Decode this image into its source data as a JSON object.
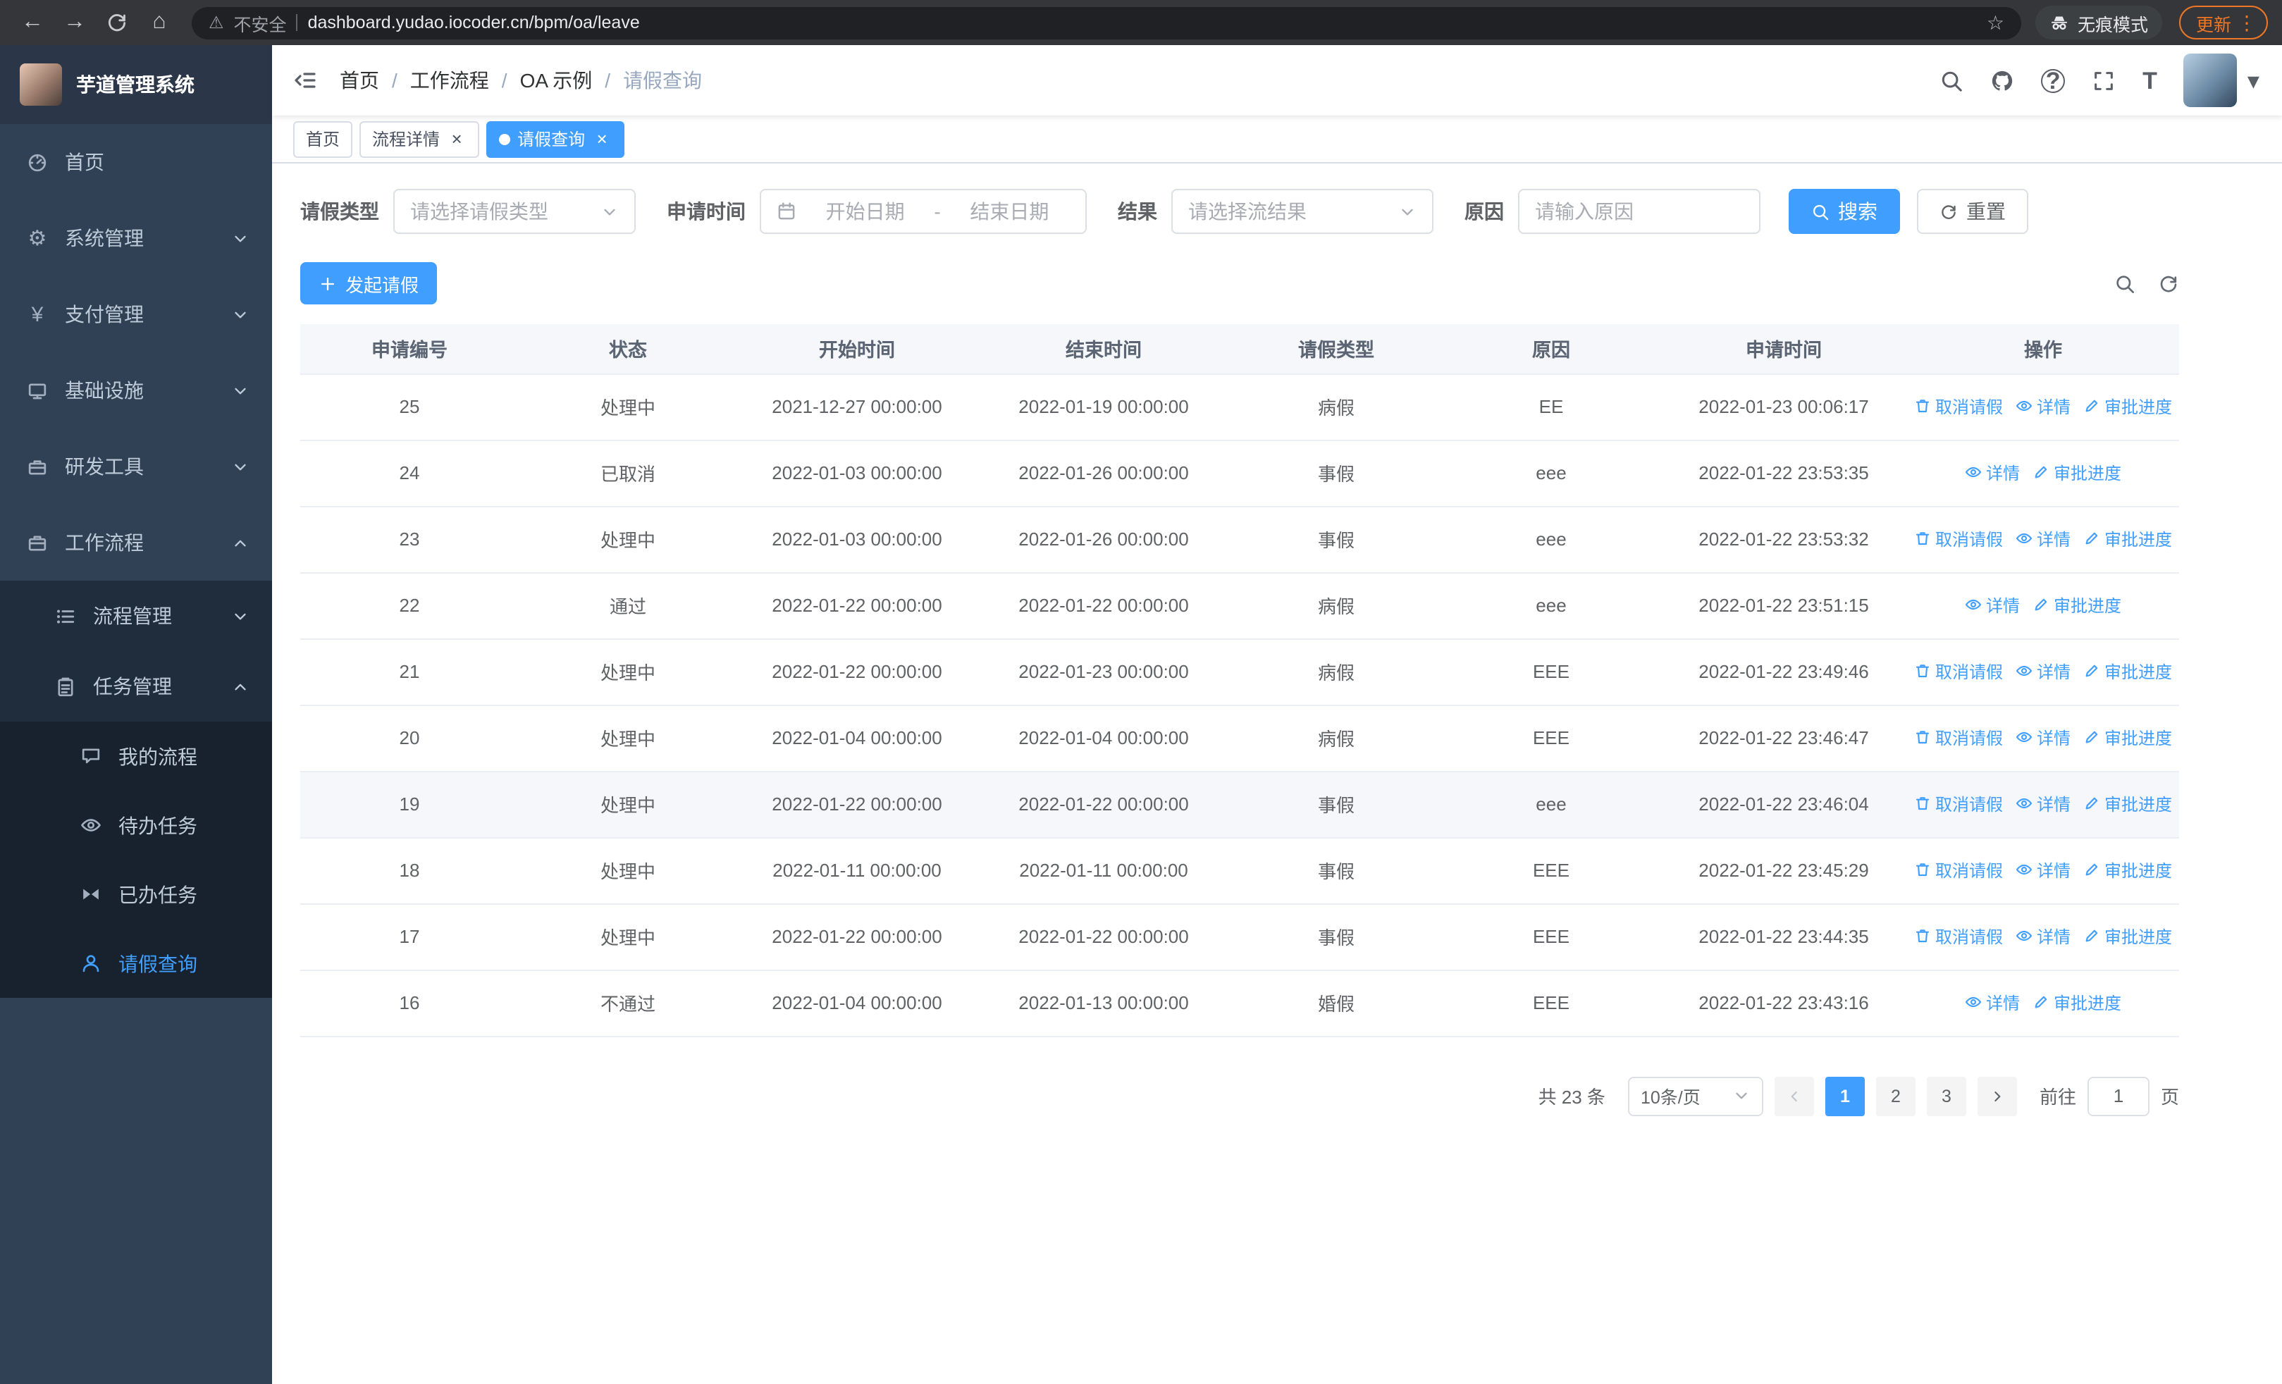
{
  "browser": {
    "security_label": "不安全",
    "url": "dashboard.yudao.iocoder.cn/bpm/oa/leave",
    "incognito_label": "无痕模式",
    "update_label": "更新"
  },
  "sidebar": {
    "logo_title": "芋道管理系统",
    "home": "首页",
    "system": "系统管理",
    "payment": "支付管理",
    "infra": "基础设施",
    "devtools": "研发工具",
    "workflow": "工作流程",
    "process_mgmt": "流程管理",
    "task_mgmt": "任务管理",
    "my_process": "我的流程",
    "todo_tasks": "待办任务",
    "done_tasks": "已办任务",
    "leave_query": "请假查询"
  },
  "breadcrumb": {
    "items": [
      "首页",
      "工作流程",
      "OA 示例",
      "请假查询"
    ],
    "separator": "/"
  },
  "tabs": [
    {
      "label": "首页"
    },
    {
      "label": "流程详情"
    },
    {
      "label": "请假查询"
    }
  ],
  "filter": {
    "type_label": "请假类型",
    "type_placeholder": "请选择请假类型",
    "time_label": "申请时间",
    "start_placeholder": "开始日期",
    "separator": "-",
    "end_placeholder": "结束日期",
    "result_label": "结果",
    "result_placeholder": "请选择流结果",
    "reason_label": "原因",
    "reason_placeholder": "请输入原因",
    "search_label": "搜索",
    "reset_label": "重置"
  },
  "toolbar": {
    "create_label": "发起请假"
  },
  "table": {
    "columns": [
      "申请编号",
      "状态",
      "开始时间",
      "结束时间",
      "请假类型",
      "原因",
      "申请时间",
      "操作"
    ],
    "action_labels": {
      "cancel": "取消请假",
      "detail": "详情",
      "progress": "审批进度"
    },
    "action_icons": {
      "cancel": "trash",
      "detail": "eye",
      "progress": "pen"
    },
    "rows": [
      {
        "id": "25",
        "status": "处理中",
        "start": "2021-12-27 00:00:00",
        "end": "2022-01-19 00:00:00",
        "type": "病假",
        "reason": "EE",
        "applied": "2022-01-23 00:06:17",
        "actions": [
          "cancel",
          "detail",
          "progress"
        ],
        "highlight": false
      },
      {
        "id": "24",
        "status": "已取消",
        "start": "2022-01-03 00:00:00",
        "end": "2022-01-26 00:00:00",
        "type": "事假",
        "reason": "eee",
        "applied": "2022-01-22 23:53:35",
        "actions": [
          "detail",
          "progress"
        ],
        "highlight": false
      },
      {
        "id": "23",
        "status": "处理中",
        "start": "2022-01-03 00:00:00",
        "end": "2022-01-26 00:00:00",
        "type": "事假",
        "reason": "eee",
        "applied": "2022-01-22 23:53:32",
        "actions": [
          "cancel",
          "detail",
          "progress"
        ],
        "highlight": false
      },
      {
        "id": "22",
        "status": "通过",
        "start": "2022-01-22 00:00:00",
        "end": "2022-01-22 00:00:00",
        "type": "病假",
        "reason": "eee",
        "applied": "2022-01-22 23:51:15",
        "actions": [
          "detail",
          "progress"
        ],
        "highlight": false
      },
      {
        "id": "21",
        "status": "处理中",
        "start": "2022-01-22 00:00:00",
        "end": "2022-01-23 00:00:00",
        "type": "病假",
        "reason": "EEE",
        "applied": "2022-01-22 23:49:46",
        "actions": [
          "cancel",
          "detail",
          "progress"
        ],
        "highlight": false
      },
      {
        "id": "20",
        "status": "处理中",
        "start": "2022-01-04 00:00:00",
        "end": "2022-01-04 00:00:00",
        "type": "病假",
        "reason": "EEE",
        "applied": "2022-01-22 23:46:47",
        "actions": [
          "cancel",
          "detail",
          "progress"
        ],
        "highlight": false
      },
      {
        "id": "19",
        "status": "处理中",
        "start": "2022-01-22 00:00:00",
        "end": "2022-01-22 00:00:00",
        "type": "事假",
        "reason": "eee",
        "applied": "2022-01-22 23:46:04",
        "actions": [
          "cancel",
          "detail",
          "progress"
        ],
        "highlight": true
      },
      {
        "id": "18",
        "status": "处理中",
        "start": "2022-01-11 00:00:00",
        "end": "2022-01-11 00:00:00",
        "type": "事假",
        "reason": "EEE",
        "applied": "2022-01-22 23:45:29",
        "actions": [
          "cancel",
          "detail",
          "progress"
        ],
        "highlight": false
      },
      {
        "id": "17",
        "status": "处理中",
        "start": "2022-01-22 00:00:00",
        "end": "2022-01-22 00:00:00",
        "type": "事假",
        "reason": "EEE",
        "applied": "2022-01-22 23:44:35",
        "actions": [
          "cancel",
          "detail",
          "progress"
        ],
        "highlight": false
      },
      {
        "id": "16",
        "status": "不通过",
        "start": "2022-01-04 00:00:00",
        "end": "2022-01-13 00:00:00",
        "type": "婚假",
        "reason": "EEE",
        "applied": "2022-01-22 23:43:16",
        "actions": [
          "detail",
          "progress"
        ],
        "highlight": false
      }
    ]
  },
  "pagination": {
    "total_text": "共 23 条",
    "page_size": "10条/页",
    "pages": [
      "1",
      "2",
      "3"
    ],
    "active_page": "1",
    "goto_label": "前往",
    "goto_value": "1",
    "page_suffix": "页"
  },
  "colors": {
    "accent": "#409eff",
    "sidebar_bg": "#304156",
    "submenu_bg": "#1f2d3d",
    "active_text": "#409eff",
    "update_accent": "#ee7624"
  },
  "icons": {
    "back": "←",
    "forward": "→",
    "reload": "@refresh",
    "home": "⌂",
    "warning": "⚠",
    "star": "☆",
    "dots": "⋮",
    "incognito": "@incognito",
    "fold": "@fold",
    "search": "@search",
    "github": "@github",
    "question": "?",
    "fullscreen": "@fullscreen",
    "fontsize": "T",
    "caret-down": "▾",
    "dashboard": "@gauge",
    "gear": "⚙",
    "yen": "¥",
    "infra": "@monitor",
    "tool": "@toolbox",
    "workflow": "@briefcase",
    "list": "@list",
    "tasks": "@clipboard",
    "chat": "@chat",
    "eye": "@eye",
    "done": "@bowtie",
    "user": "@user",
    "chevron-down": "@chev-down",
    "chevron-up": "@chev-up",
    "chevron-left": "@chev-left",
    "chevron-right": "@chev-right",
    "calendar": "@calendar",
    "plus": "@plus",
    "refresh": "@refresh",
    "trash": "@trash",
    "pen": "@pen",
    "close": "×"
  }
}
